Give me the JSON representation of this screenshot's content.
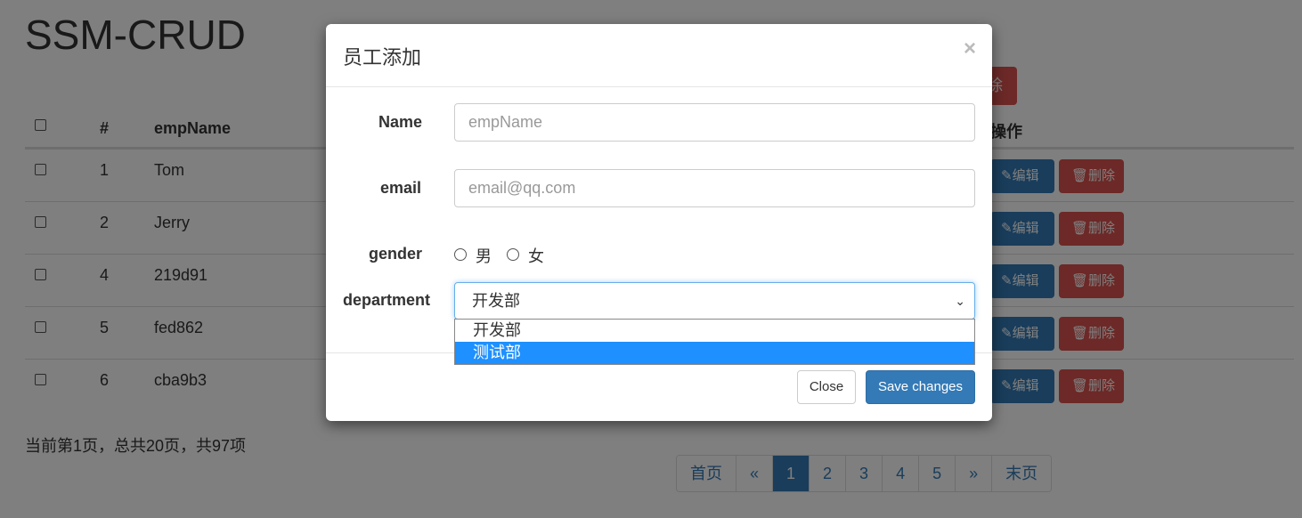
{
  "page": {
    "title": "SSM-CRUD",
    "top_delete_label": "除",
    "table": {
      "headers": {
        "id": "#",
        "name": "empName",
        "ops": "操作"
      },
      "rows": [
        {
          "id": "1",
          "name": "Tom"
        },
        {
          "id": "2",
          "name": "Jerry"
        },
        {
          "id": "4",
          "name": "219d91"
        },
        {
          "id": "5",
          "name": "fed862"
        },
        {
          "id": "6",
          "name": "cba9b3"
        }
      ],
      "edit_label": "✎编辑",
      "delete_label": "🗑删除"
    },
    "page_info": "当前第1页，总共20页，共97项",
    "pagination": [
      "首页",
      "«",
      "1",
      "2",
      "3",
      "4",
      "5",
      "»",
      "末页"
    ],
    "active_page": "1"
  },
  "modal": {
    "title": "员工添加",
    "close_symbol": "×",
    "fields": {
      "name": {
        "label": "Name",
        "placeholder": "empName"
      },
      "email": {
        "label": "email",
        "placeholder": "email@qq.com"
      },
      "gender": {
        "label": "gender",
        "options": [
          "男",
          "女"
        ]
      },
      "department": {
        "label": "department",
        "selected": "开发部",
        "options": [
          "开发部",
          "测试部"
        ],
        "highlighted": "测试部"
      }
    },
    "footer": {
      "close_label": "Close",
      "save_label": "Save changes"
    }
  },
  "colors": {
    "primary": "#337ab7",
    "danger": "#d9534f",
    "highlight": "#1e90ff"
  }
}
